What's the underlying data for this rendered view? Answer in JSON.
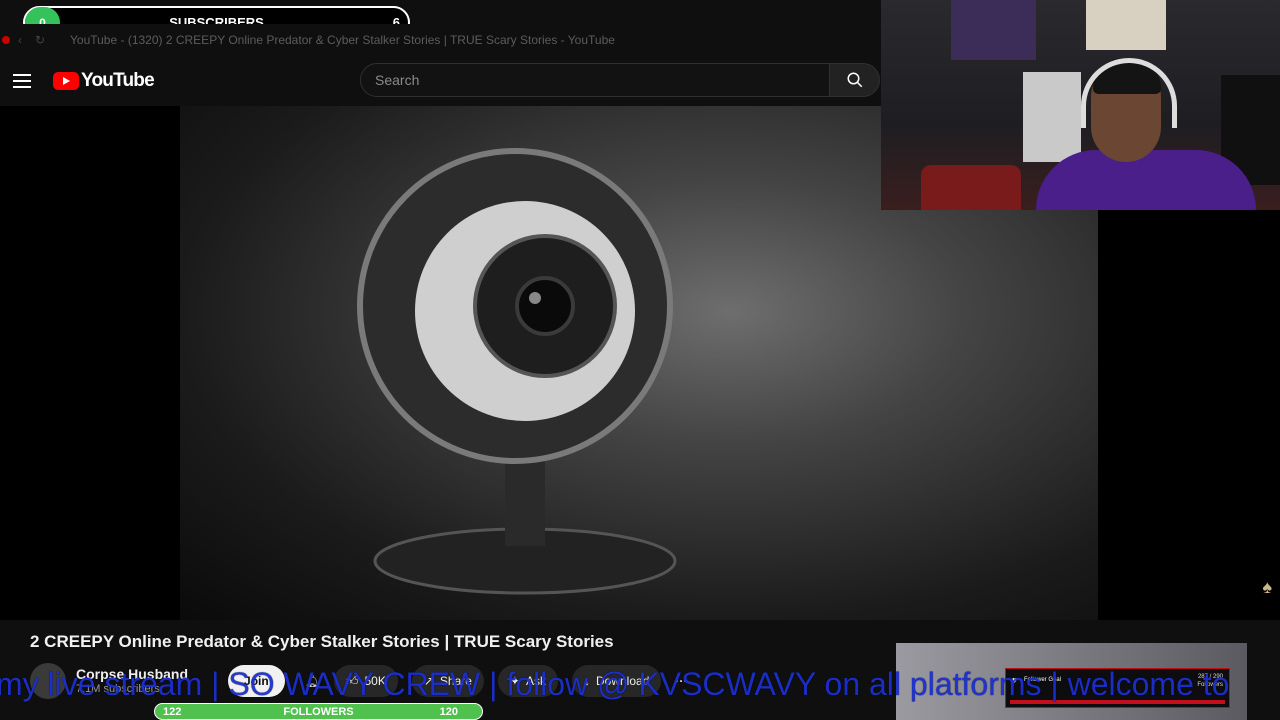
{
  "browser": {
    "tab_title": "YouTube - (1320) 2 CREEPY Online Predator & Cyber Stalker Stories | TRUE Scary Stories - YouTube"
  },
  "header": {
    "logo_text": "YouTube",
    "search_placeholder": "Search"
  },
  "video": {
    "title": "2 CREEPY Online Predator & Cyber Stalker Stories | TRUE Scary Stories",
    "channel_name": "Corpse Husband",
    "channel_subs": "7.1M subscribers",
    "join_label": "Join",
    "likes_label": "50K",
    "share_label": "Share",
    "ask_label": "Ask",
    "download_label": "Download"
  },
  "overlay": {
    "subs_current": "0",
    "subs_label": "SUBSCRIBERS",
    "subs_target": "6",
    "ticker_text": "my live stream | SO WAVY CREW | follow @ KVSCWAVY on all platforms | welcome to",
    "followers_current": "122",
    "followers_label": "FOLLOWERS",
    "followers_target": "120",
    "follower_goal_label": "Follower Goal",
    "follower_goal_count": "287 / 290",
    "follower_goal_unit": "Followers"
  },
  "colors": {
    "accent_red": "#ff0000",
    "ticker_blue": "#1b2fd0",
    "progress_green": "#4fc14c"
  }
}
